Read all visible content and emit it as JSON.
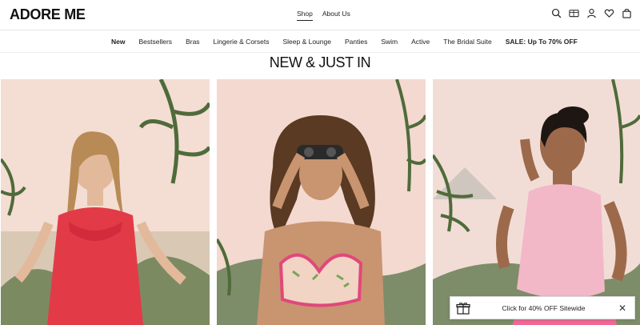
{
  "brand": {
    "logo": "ADORE ME"
  },
  "header": {
    "nav": [
      {
        "label": "Shop",
        "active": true
      },
      {
        "label": "About Us",
        "active": false
      }
    ],
    "icons": [
      "search-icon",
      "gift-card-icon",
      "account-icon",
      "wishlist-heart-icon",
      "shopping-bag-icon"
    ]
  },
  "categories": [
    {
      "label": "New",
      "bold": true
    },
    {
      "label": "Bestsellers",
      "bold": false
    },
    {
      "label": "Bras",
      "bold": false
    },
    {
      "label": "Lingerie & Corsets",
      "bold": false
    },
    {
      "label": "Sleep & Lounge",
      "bold": false
    },
    {
      "label": "Panties",
      "bold": false
    },
    {
      "label": "Swim",
      "bold": false
    },
    {
      "label": "Active",
      "bold": false
    },
    {
      "label": "The Bridal Suite",
      "bold": false
    },
    {
      "label": "SALE: Up To 70% OFF",
      "bold": true
    }
  ],
  "section": {
    "title": "NEW & JUST IN"
  },
  "products": [
    {
      "image": "model in red satin slip with lace trim"
    },
    {
      "image": "model with binoculars in floral bra"
    },
    {
      "image": "model in pink lounge cami"
    }
  ],
  "promo": {
    "text": "Click for 40% OFF Sitewide",
    "close": "✕"
  },
  "colors": {
    "backdrop": "#f3ddd2",
    "foliage": "#4f6b3a",
    "accent_red": "#e23b47",
    "accent_pink": "#e0487a"
  }
}
